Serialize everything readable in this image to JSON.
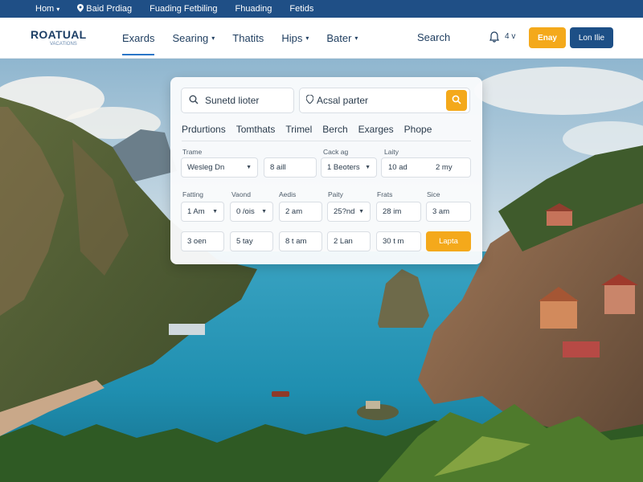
{
  "topbar": {
    "items": [
      {
        "label": "Hom",
        "caret": true
      },
      {
        "label": "Baid Prdiag",
        "icon": "location-pin-icon"
      },
      {
        "label": "Fuading Fetbiling"
      },
      {
        "label": "Fhuading"
      },
      {
        "label": "Fetids"
      }
    ]
  },
  "header": {
    "logo": "ROATUAL",
    "logo_sub": "VACATIONS",
    "nav": [
      {
        "label": "Exards",
        "active": true,
        "caret": false
      },
      {
        "label": "Searing",
        "caret": true
      },
      {
        "label": "Thatits",
        "caret": false
      },
      {
        "label": "Hips",
        "caret": true
      },
      {
        "label": "Bater",
        "caret": true
      }
    ],
    "search_label": "Search",
    "lang_label": "4 v",
    "primary_button": "Enay",
    "secondary_button": "Lon Ilie"
  },
  "search": {
    "destination_placeholder": "Sunetd lioter",
    "departure_placeholder": "Acsal parter",
    "tabs": [
      "Prdurtions",
      "Tomthats",
      "Trimel",
      "Berch",
      "Exarges",
      "Phope"
    ],
    "row1": {
      "labels": [
        "Trame",
        "Cack ag",
        "Laity"
      ],
      "values": [
        "Wesleg Dn",
        "8 aill",
        "1 Beoters",
        "10 ad",
        "2 my"
      ]
    },
    "row2": {
      "labels": [
        "Fatting",
        "Vaond",
        "Aedis",
        "Paity",
        "Frats",
        "Sice"
      ],
      "values": [
        "1 Am",
        "0 /ois",
        "2 am",
        "25?nd",
        "28 im",
        "3 am"
      ]
    },
    "row3": {
      "values": [
        "3 oen",
        "5 tay",
        "8 t am",
        "2 Lan",
        "30 t m"
      ]
    },
    "apply_label": "Lapta"
  },
  "colors": {
    "topbar": "#1f4f86",
    "accent": "#f4a91b",
    "brand": "#1d4f86"
  }
}
